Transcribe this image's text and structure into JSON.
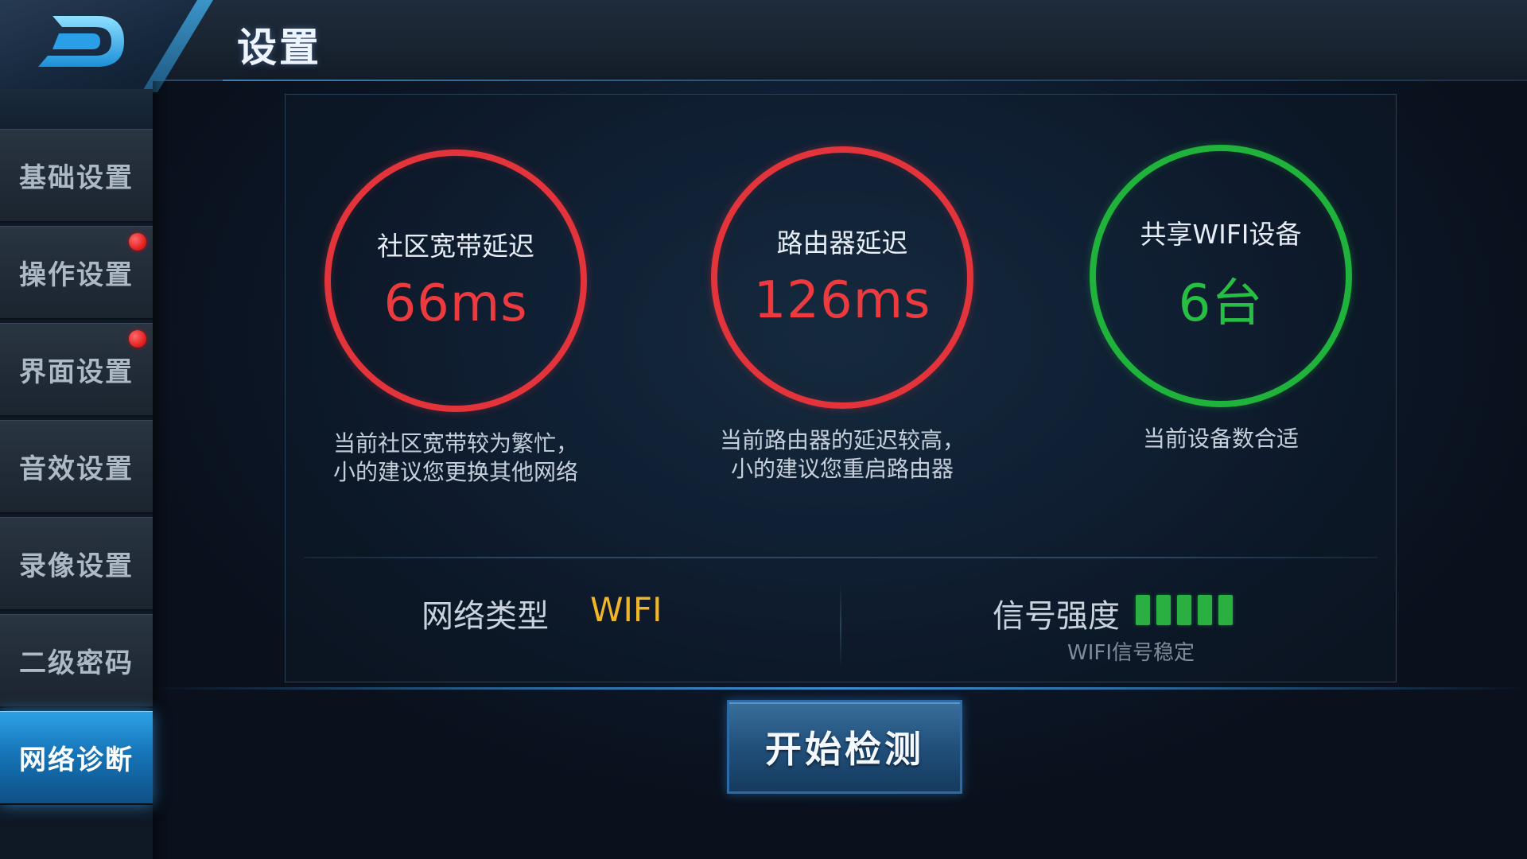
{
  "header": {
    "title": "设置",
    "back_icon": "back-arrow-icon"
  },
  "sidebar": {
    "items": [
      {
        "label": "基础设置",
        "active": false,
        "badge": false
      },
      {
        "label": "操作设置",
        "active": false,
        "badge": true
      },
      {
        "label": "界面设置",
        "active": false,
        "badge": true
      },
      {
        "label": "音效设置",
        "active": false,
        "badge": false
      },
      {
        "label": "录像设置",
        "active": false,
        "badge": false
      },
      {
        "label": "二级密码",
        "active": false,
        "badge": false
      },
      {
        "label": "网络诊断",
        "active": true,
        "badge": false
      }
    ]
  },
  "meters": [
    {
      "title": "社区宽带延迟",
      "value": "66ms",
      "status_color": "#e2343a",
      "advice_line1": "当前社区宽带较为繁忙，",
      "advice_line2": "小的建议您更换其他网络"
    },
    {
      "title": "路由器延迟",
      "value": "126ms",
      "status_color": "#e2343a",
      "advice_line1": "当前路由器的延迟较高，",
      "advice_line2": "小的建议您重启路由器"
    },
    {
      "title": "共享WIFI设备",
      "value": "6台",
      "status_color": "#1fb33b",
      "advice_line1": "当前设备数合适",
      "advice_line2": ""
    }
  ],
  "network": {
    "type_label": "网络类型",
    "type_value": "WIFI",
    "signal_label": "信号强度",
    "signal_bars": 5,
    "signal_note": "WIFI信号稳定"
  },
  "actions": {
    "start_label": "开始检测"
  },
  "colors": {
    "warning": "#e2343a",
    "ok": "#1fb33b",
    "accent": "#2da1e6",
    "wifi_value": "#f0b62a"
  }
}
